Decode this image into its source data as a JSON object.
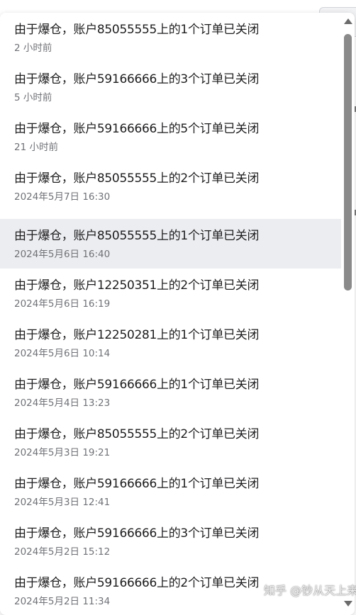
{
  "notifications": [
    {
      "message": "由于爆仓，账户85055555上的1个订单已关闭",
      "time": "2 小时前"
    },
    {
      "message": "由于爆仓，账户59166666上的3个订单已关闭",
      "time": "5 小时前"
    },
    {
      "message": "由于爆仓，账户59166666上的5个订单已关闭",
      "time": "21 小时前"
    },
    {
      "message": "由于爆仓，账户85055555上的2个订单已关闭",
      "time": "2024年5月7日 16:30"
    },
    {
      "message": "由于爆仓，账户85055555上的1个订单已关闭",
      "time": "2024年5月6日 16:40"
    },
    {
      "message": "由于爆仓，账户12250351上的2个订单已关闭",
      "time": "2024年5月6日 16:19"
    },
    {
      "message": "由于爆仓，账户12250281上的1个订单已关闭",
      "time": "2024年5月6日 10:14"
    },
    {
      "message": "由于爆仓，账户59166666上的1个订单已关闭",
      "time": "2024年5月4日 13:23"
    },
    {
      "message": "由于爆仓，账户85055555上的2个订单已关闭",
      "time": "2024年5月3日 19:21"
    },
    {
      "message": "由于爆仓，账户59166666上的1个订单已关闭",
      "time": "2024年5月3日 12:41"
    },
    {
      "message": "由于爆仓，账户59166666上的3个订单已关闭",
      "time": "2024年5月2日 15:12"
    },
    {
      "message": "由于爆仓，账户59166666上的2个订单已关闭",
      "time": "2024年5月2日 11:34"
    }
  ],
  "highlighted_index": 4,
  "watermark": "知乎 @钞从天上来",
  "colors": {
    "hover_background": "#ecedf0",
    "message_text": "#1d1d1f",
    "time_text": "#707277",
    "scrollbar_thumb": "#8a8a8a"
  },
  "icons": {
    "scroll_up": "triangle-up",
    "scroll_down": "triangle-down"
  }
}
